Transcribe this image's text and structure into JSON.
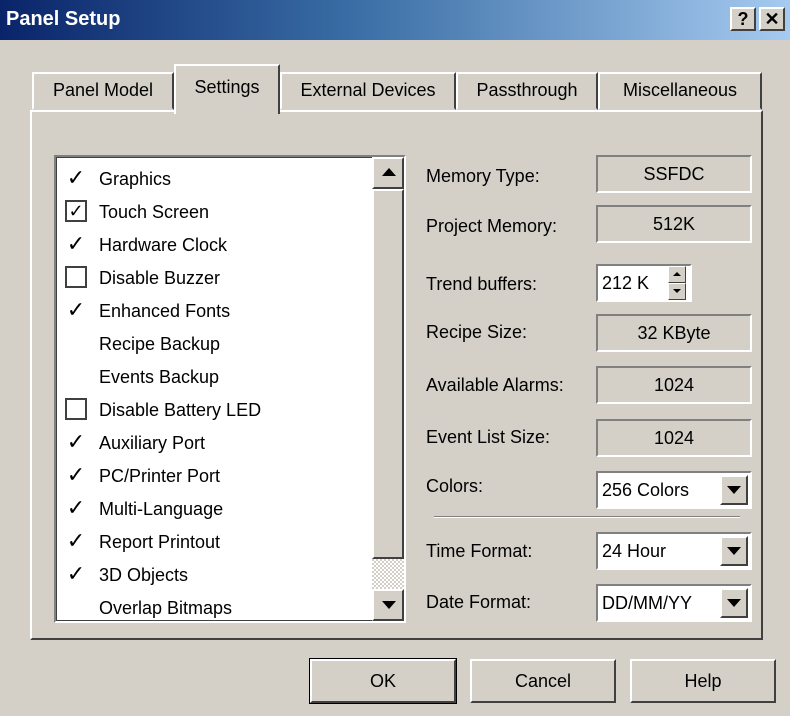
{
  "window": {
    "title": "Panel Setup",
    "help_glyph": "?",
    "close_glyph": "✕"
  },
  "tabs": [
    {
      "label": "Panel Model",
      "active": false
    },
    {
      "label": "Settings",
      "active": true
    },
    {
      "label": "External Devices",
      "active": false
    },
    {
      "label": "Passthrough",
      "active": false
    },
    {
      "label": "Miscellaneous",
      "active": false
    }
  ],
  "options_list": [
    {
      "label": "Graphics",
      "mark": "✓"
    },
    {
      "label": "Touch Screen",
      "mark": "✓"
    },
    {
      "label": "Hardware Clock",
      "mark": "✓"
    },
    {
      "label": "Disable Buzzer",
      "mark": ""
    },
    {
      "label": "Enhanced Fonts",
      "mark": "✓"
    },
    {
      "label": "Recipe Backup",
      "mark": ""
    },
    {
      "label": "Events Backup",
      "mark": ""
    },
    {
      "label": "Disable Battery LED",
      "mark": ""
    },
    {
      "label": "Auxiliary Port",
      "mark": "✓"
    },
    {
      "label": "PC/Printer Port",
      "mark": "✓"
    },
    {
      "label": "Multi-Language",
      "mark": "✓"
    },
    {
      "label": "Report Printout",
      "mark": "✓"
    },
    {
      "label": "3D Objects",
      "mark": "✓"
    },
    {
      "label": "Overlap Bitmaps",
      "mark": ""
    }
  ],
  "fields": {
    "memory_type": {
      "label": "Memory Type:",
      "value": "SSFDC"
    },
    "project_memory": {
      "label": "Project Memory:",
      "value": "512K"
    },
    "trend_buffers": {
      "label": "Trend buffers:",
      "value": "212 K"
    },
    "recipe_size": {
      "label": "Recipe Size:",
      "value": "32 KByte"
    },
    "available_alarms": {
      "label": "Available Alarms:",
      "value": "1024"
    },
    "event_list_size": {
      "label": "Event List Size:",
      "value": "1024"
    },
    "colors": {
      "label": "Colors:",
      "value": "256 Colors"
    },
    "time_format": {
      "label": "Time Format:",
      "value": "24 Hour"
    },
    "date_format": {
      "label": "Date Format:",
      "value": "DD/MM/YY"
    }
  },
  "buttons": {
    "ok": "OK",
    "cancel": "Cancel",
    "help": "Help"
  },
  "colors": {
    "titlebar_start": "#0a246a",
    "titlebar_end": "#a6caf0",
    "face": "#d4d0c8"
  }
}
